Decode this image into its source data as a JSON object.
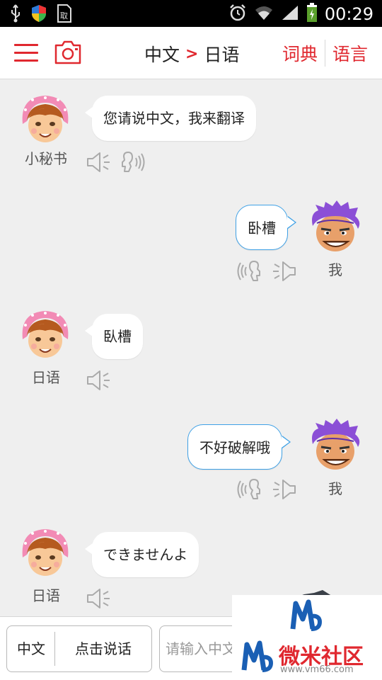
{
  "status_bar": {
    "time": "00:29",
    "icons": [
      "usb-icon",
      "shield-icon",
      "sim-icon",
      "alarm-icon",
      "wifi-icon",
      "signal-icon",
      "battery-icon"
    ]
  },
  "header": {
    "menu_icon": "menu-icon",
    "camera_icon": "camera-icon",
    "source_lang": "中文",
    "arrow": ">",
    "target_lang": "日语",
    "dictionary_label": "词典",
    "language_label": "语言",
    "accent_color": "#e0282f"
  },
  "chat": {
    "messages": [
      {
        "side": "left",
        "name": "小秘书",
        "text": "您请说中文，我来翻译",
        "icons": [
          "speaker-icon",
          "ear-icon"
        ]
      },
      {
        "side": "right",
        "name": "我",
        "text": "卧槽",
        "icons": [
          "ear-icon",
          "speaker-icon"
        ]
      },
      {
        "side": "left",
        "name": "日语",
        "text": "臥槽",
        "icons": [
          "speaker-icon"
        ]
      },
      {
        "side": "right",
        "name": "我",
        "text": "不好破解哦",
        "icons": [
          "ear-icon",
          "speaker-icon"
        ]
      },
      {
        "side": "left",
        "name": "日语",
        "text": "できませんよ",
        "icons": [
          "speaker-icon"
        ]
      }
    ],
    "bubble_border_color": "#3fa1e6"
  },
  "input_bar": {
    "voice_lang": "中文",
    "voice_button": "点击说话",
    "text_placeholder": "请输入中文"
  },
  "watermark": {
    "brand": "微米社区",
    "url": "www.vm66.com"
  }
}
